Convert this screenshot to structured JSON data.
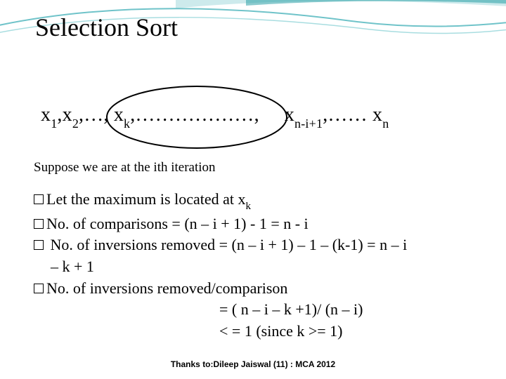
{
  "title": "Selection Sort",
  "sequence": {
    "part1_prefix": "x",
    "part1_sub1": "1",
    "part1_mid1": ",x",
    "part1_sub2": "2",
    "part1_mid2": ",…, x",
    "part1_sub3": "k",
    "part1_trail": ",………………,",
    "part2_prefix": "x",
    "part2_sub1": "n-i+1",
    "part2_mid": ",…… x",
    "part2_sub2": "n"
  },
  "suppose": "Suppose we are at the ith iteration",
  "bullets": {
    "b1_pre": "Let the maximum is located at x",
    "b1_sub": "k",
    "b2": "No. of comparisons =  (n – i + 1) - 1 = n - i",
    "b3a": " No. of inversions removed = (n – i + 1) – 1 – (k-1) = n – i",
    "b3b": "– k + 1",
    "b4": "No. of inversions removed/comparison",
    "b4_eq1": "= ( n – i – k +1)/ (n – i)",
    "b4_eq2": "< = 1 (since k >= 1)"
  },
  "footer": "Thanks to:Dileep Jaiswal (11) : MCA 2012"
}
